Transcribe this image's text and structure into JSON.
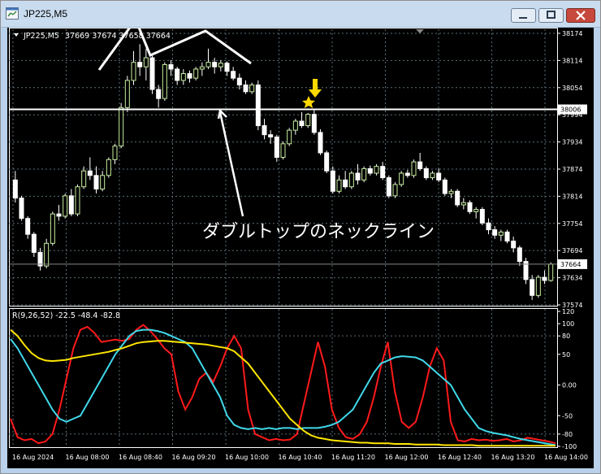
{
  "window": {
    "title": "JP225,M5"
  },
  "price_header": {
    "symbol": "JP225,M5",
    "ohlc": "37669 37674 37658 37664"
  },
  "indicator_header": {
    "label": "R(9,26,52) -22.5 -48.4 -82.8"
  },
  "annotation": {
    "text": "ダブルトップのネックライン"
  },
  "colors": {
    "background": "#000000",
    "grid": "#5a6e7a",
    "bull_candle": "#c8f0a0",
    "bear_candle": "#ffffff",
    "wick": "#ffffff",
    "neckline": "#ffffff",
    "marker": "#ffd800",
    "rsi_fast": "#ff1a1a",
    "rsi_mid": "#40d8ea",
    "rsi_slow": "#ffe600"
  },
  "chart_data": [
    {
      "type": "candlestick",
      "title": "JP225,M5",
      "y_ticks": [
        "38174",
        "38114",
        "38054",
        "37994",
        "37934",
        "37874",
        "37814",
        "37754",
        "37694",
        "37634",
        "37574"
      ],
      "ylim": [
        37574,
        38174
      ],
      "price_labels": {
        "neckline": "38006",
        "current": "37664"
      },
      "neckline_level": 38006,
      "current_price": 37664,
      "candles": [
        {
          "o": 37850,
          "h": 37870,
          "l": 37800,
          "c": 37810
        },
        {
          "o": 37810,
          "h": 37815,
          "l": 37760,
          "c": 37765
        },
        {
          "o": 37765,
          "h": 37770,
          "l": 37720,
          "c": 37730
        },
        {
          "o": 37730,
          "h": 37735,
          "l": 37680,
          "c": 37690
        },
        {
          "o": 37690,
          "h": 37700,
          "l": 37650,
          "c": 37660
        },
        {
          "o": 37660,
          "h": 37720,
          "l": 37655,
          "c": 37710
        },
        {
          "o": 37710,
          "h": 37780,
          "l": 37705,
          "c": 37775
        },
        {
          "o": 37775,
          "h": 37795,
          "l": 37760,
          "c": 37770
        },
        {
          "o": 37770,
          "h": 37820,
          "l": 37765,
          "c": 37815
        },
        {
          "o": 37815,
          "h": 37830,
          "l": 37770,
          "c": 37775
        },
        {
          "o": 37775,
          "h": 37840,
          "l": 37770,
          "c": 37835
        },
        {
          "o": 37835,
          "h": 37880,
          "l": 37830,
          "c": 37870
        },
        {
          "o": 37870,
          "h": 37900,
          "l": 37850,
          "c": 37860
        },
        {
          "o": 37860,
          "h": 37880,
          "l": 37820,
          "c": 37830
        },
        {
          "o": 37830,
          "h": 37870,
          "l": 37825,
          "c": 37860
        },
        {
          "o": 37860,
          "h": 37900,
          "l": 37855,
          "c": 37895
        },
        {
          "o": 37895,
          "h": 37930,
          "l": 37885,
          "c": 37925
        },
        {
          "o": 37925,
          "h": 38020,
          "l": 37920,
          "c": 38010
        },
        {
          "o": 38010,
          "h": 38080,
          "l": 38000,
          "c": 38070
        },
        {
          "o": 38070,
          "h": 38135,
          "l": 38060,
          "c": 38110
        },
        {
          "o": 38110,
          "h": 38150,
          "l": 38080,
          "c": 38100
        },
        {
          "o": 38100,
          "h": 38140,
          "l": 38070,
          "c": 38120
        },
        {
          "o": 38120,
          "h": 38130,
          "l": 38040,
          "c": 38050
        },
        {
          "o": 38050,
          "h": 38060,
          "l": 38010,
          "c": 38030
        },
        {
          "o": 38030,
          "h": 38110,
          "l": 38025,
          "c": 38105
        },
        {
          "o": 38105,
          "h": 38115,
          "l": 38080,
          "c": 38095
        },
        {
          "o": 38095,
          "h": 38100,
          "l": 38060,
          "c": 38070
        },
        {
          "o": 38070,
          "h": 38095,
          "l": 38060,
          "c": 38085
        },
        {
          "o": 38085,
          "h": 38092,
          "l": 38065,
          "c": 38075
        },
        {
          "o": 38075,
          "h": 38100,
          "l": 38070,
          "c": 38095
        },
        {
          "o": 38095,
          "h": 38110,
          "l": 38080,
          "c": 38100
        },
        {
          "o": 38100,
          "h": 38140,
          "l": 38095,
          "c": 38110
        },
        {
          "o": 38110,
          "h": 38120,
          "l": 38085,
          "c": 38100
        },
        {
          "o": 38100,
          "h": 38115,
          "l": 38090,
          "c": 38108
        },
        {
          "o": 38108,
          "h": 38112,
          "l": 38080,
          "c": 38090
        },
        {
          "o": 38090,
          "h": 38100,
          "l": 38070,
          "c": 38075
        },
        {
          "o": 38075,
          "h": 38085,
          "l": 38050,
          "c": 38060
        },
        {
          "o": 38060,
          "h": 38070,
          "l": 38040,
          "c": 38045
        },
        {
          "o": 38045,
          "h": 38065,
          "l": 38040,
          "c": 38060
        },
        {
          "o": 38060,
          "h": 38070,
          "l": 37960,
          "c": 37970
        },
        {
          "o": 37970,
          "h": 37985,
          "l": 37940,
          "c": 37950
        },
        {
          "o": 37950,
          "h": 37960,
          "l": 37930,
          "c": 37945
        },
        {
          "o": 37945,
          "h": 37950,
          "l": 37890,
          "c": 37900
        },
        {
          "o": 37900,
          "h": 37935,
          "l": 37895,
          "c": 37930
        },
        {
          "o": 37930,
          "h": 37965,
          "l": 37925,
          "c": 37960
        },
        {
          "o": 37960,
          "h": 37985,
          "l": 37950,
          "c": 37980
        },
        {
          "o": 37980,
          "h": 38000,
          "l": 37965,
          "c": 37970
        },
        {
          "o": 37970,
          "h": 37998,
          "l": 37965,
          "c": 37995
        },
        {
          "o": 37995,
          "h": 38005,
          "l": 37950,
          "c": 37955
        },
        {
          "o": 37955,
          "h": 37962,
          "l": 37905,
          "c": 37910
        },
        {
          "o": 37910,
          "h": 37915,
          "l": 37865,
          "c": 37870
        },
        {
          "o": 37870,
          "h": 37880,
          "l": 37820,
          "c": 37825
        },
        {
          "o": 37825,
          "h": 37860,
          "l": 37820,
          "c": 37850
        },
        {
          "o": 37850,
          "h": 37870,
          "l": 37830,
          "c": 37835
        },
        {
          "o": 37835,
          "h": 37870,
          "l": 37830,
          "c": 37865
        },
        {
          "o": 37865,
          "h": 37885,
          "l": 37840,
          "c": 37850
        },
        {
          "o": 37850,
          "h": 37880,
          "l": 37845,
          "c": 37875
        },
        {
          "o": 37875,
          "h": 37882,
          "l": 37860,
          "c": 37865
        },
        {
          "o": 37865,
          "h": 37885,
          "l": 37860,
          "c": 37880
        },
        {
          "o": 37880,
          "h": 37890,
          "l": 37850,
          "c": 37855
        },
        {
          "o": 37855,
          "h": 37860,
          "l": 37810,
          "c": 37815
        },
        {
          "o": 37815,
          "h": 37845,
          "l": 37810,
          "c": 37840
        },
        {
          "o": 37840,
          "h": 37870,
          "l": 37835,
          "c": 37865
        },
        {
          "o": 37865,
          "h": 37872,
          "l": 37855,
          "c": 37860
        },
        {
          "o": 37860,
          "h": 37895,
          "l": 37855,
          "c": 37890
        },
        {
          "o": 37890,
          "h": 37910,
          "l": 37870,
          "c": 37875
        },
        {
          "o": 37875,
          "h": 37880,
          "l": 37850,
          "c": 37855
        },
        {
          "o": 37855,
          "h": 37870,
          "l": 37850,
          "c": 37865
        },
        {
          "o": 37865,
          "h": 37875,
          "l": 37845,
          "c": 37850
        },
        {
          "o": 37850,
          "h": 37855,
          "l": 37815,
          "c": 37820
        },
        {
          "o": 37820,
          "h": 37830,
          "l": 37810,
          "c": 37825
        },
        {
          "o": 37825,
          "h": 37830,
          "l": 37790,
          "c": 37795
        },
        {
          "o": 37795,
          "h": 37810,
          "l": 37785,
          "c": 37800
        },
        {
          "o": 37800,
          "h": 37805,
          "l": 37775,
          "c": 37780
        },
        {
          "o": 37780,
          "h": 37790,
          "l": 37765,
          "c": 37785
        },
        {
          "o": 37785,
          "h": 37790,
          "l": 37750,
          "c": 37755
        },
        {
          "o": 37755,
          "h": 37765,
          "l": 37730,
          "c": 37740
        },
        {
          "o": 37740,
          "h": 37748,
          "l": 37720,
          "c": 37728
        },
        {
          "o": 37728,
          "h": 37740,
          "l": 37715,
          "c": 37735
        },
        {
          "o": 37735,
          "h": 37740,
          "l": 37710,
          "c": 37715
        },
        {
          "o": 37715,
          "h": 37725,
          "l": 37690,
          "c": 37700
        },
        {
          "o": 37700,
          "h": 37705,
          "l": 37660,
          "c": 37670
        },
        {
          "o": 37670,
          "h": 37678,
          "l": 37620,
          "c": 37630
        },
        {
          "o": 37630,
          "h": 37640,
          "l": 37585,
          "c": 37595
        },
        {
          "o": 37595,
          "h": 37640,
          "l": 37590,
          "c": 37635
        },
        {
          "o": 37635,
          "h": 37650,
          "l": 37620,
          "c": 37628
        },
        {
          "o": 37628,
          "h": 37668,
          "l": 37625,
          "c": 37664
        }
      ]
    },
    {
      "type": "line",
      "title": "R(9,26,52) -22.5 -48.4 -82.8",
      "y_ticks": [
        "120",
        "100",
        "80",
        "50",
        "0.00",
        "-50",
        "-80",
        "-100"
      ],
      "ylim": [
        -100,
        120
      ],
      "x_ticks": [
        "16 Aug 2024",
        "16 Aug 08:00",
        "16 Aug 08:40",
        "16 Aug 09:20",
        "16 Aug 10:00",
        "16 Aug 10:40",
        "16 Aug 11:20",
        "16 Aug 12:00",
        "16 Aug 12:40",
        "16 Aug 13:20",
        "16 Aug 14:00"
      ],
      "series": [
        {
          "color": "#ff1a1a",
          "values": [
            -55,
            -85,
            -90,
            -88,
            -95,
            -92,
            -80,
            -40,
            10,
            60,
            90,
            95,
            85,
            70,
            72,
            74,
            72,
            75,
            90,
            98,
            88,
            75,
            60,
            50,
            -10,
            -40,
            -20,
            10,
            20,
            5,
            30,
            60,
            80,
            60,
            -40,
            -80,
            -85,
            -90,
            -88,
            -90,
            -89,
            -80,
            -30,
            20,
            70,
            30,
            -40,
            -70,
            -85,
            -88,
            -80,
            -60,
            -20,
            30,
            70,
            -10,
            -60,
            -70,
            -60,
            -20,
            30,
            60,
            40,
            -60,
            -90,
            -92,
            -88,
            -90,
            -89,
            -91,
            -90,
            -88,
            -92,
            -90,
            -86,
            -88,
            -90,
            -92,
            -95
          ]
        },
        {
          "color": "#40d8ea",
          "values": [
            75,
            60,
            40,
            20,
            0,
            -20,
            -40,
            -55,
            -60,
            -55,
            -50,
            -30,
            -10,
            10,
            30,
            50,
            65,
            80,
            88,
            90,
            90,
            88,
            85,
            80,
            75,
            70,
            60,
            40,
            20,
            0,
            -20,
            -50,
            -65,
            -70,
            -72,
            -70,
            -72,
            -70,
            -72,
            -70,
            -70,
            -72,
            -70,
            -70,
            -70,
            -68,
            -65,
            -60,
            -50,
            -40,
            -20,
            0,
            20,
            35,
            40,
            45,
            47,
            46,
            45,
            40,
            30,
            20,
            10,
            0,
            -20,
            -40,
            -55,
            -70,
            -75,
            -78,
            -80,
            -82,
            -85,
            -88,
            -90,
            -92,
            -94,
            -96,
            -98
          ]
        },
        {
          "color": "#ffe600",
          "values": [
            90,
            80,
            65,
            52,
            44,
            40,
            39,
            40,
            41,
            44,
            46,
            48,
            50,
            52,
            54,
            57,
            60,
            64,
            68,
            70,
            71,
            72,
            72,
            71,
            70,
            69,
            68,
            67,
            66,
            64,
            62,
            60,
            55,
            45,
            35,
            20,
            5,
            -10,
            -25,
            -40,
            -55,
            -65,
            -75,
            -82,
            -86,
            -88,
            -90,
            -91,
            -92,
            -93,
            -94,
            -94,
            -95,
            -95,
            -95,
            -96,
            -96,
            -96,
            -97,
            -97,
            -97,
            -97,
            -98,
            -98,
            -98,
            -98,
            -98,
            -99,
            -99,
            -99,
            -99,
            -99,
            -99,
            -99,
            -99,
            -99,
            -99,
            -99,
            -99
          ]
        }
      ]
    }
  ]
}
